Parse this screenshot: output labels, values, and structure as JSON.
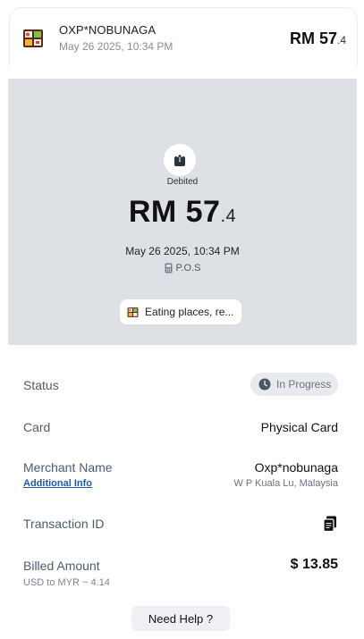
{
  "header": {
    "merchant": "OXP*NOBUNAGA",
    "datetime": "May 26 2025, 10:34 PM",
    "amount_main": "RM 57",
    "amount_dec": ".4"
  },
  "summary": {
    "type_label": "Debited",
    "amount_main": "RM 57",
    "amount_dec": ".4",
    "datetime": "May 26 2025, 10:34 PM",
    "channel": "P.O.S",
    "category": "Eating places, re..."
  },
  "details": {
    "status_label": "Status",
    "status_value": "In Progress",
    "card_label": "Card",
    "card_value": "Physical Card",
    "merchant_label": "Merchant Name",
    "merchant_value": "Oxp*nobunaga",
    "additional_info": "Additional Info",
    "location": "W P Kuala Lu, Malaysia",
    "txn_label": "Transaction ID",
    "billed_label": "Billed Amount",
    "billed_value": "$ 13.85",
    "fx_rate": "USD to MYR ~ 4.14"
  },
  "help_label": "Need Help ?",
  "icons": {
    "merchant": "bento-box-icon",
    "debit": "upload-arrow-icon",
    "pos": "pos-terminal-icon",
    "status": "clock-icon",
    "copy": "copy-icon"
  },
  "colors": {
    "panel": "#dde0e4",
    "link": "#1a5aa8",
    "label": "#4f5c70"
  }
}
